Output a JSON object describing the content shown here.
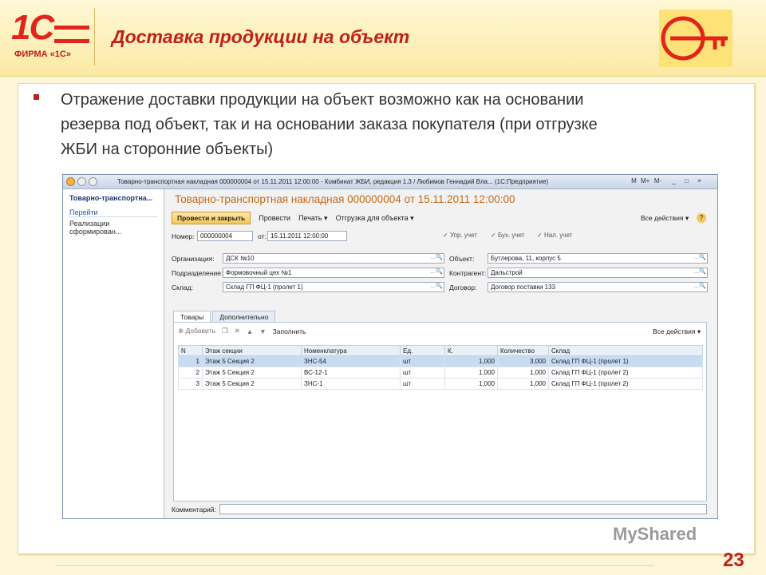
{
  "slide": {
    "title": "Доставка продукции на объект",
    "logo_text": "1С",
    "logo_sub": "ФИРМА «1С»",
    "bullet_lines": [
      "Отражение доставки продукции на объект возможно как на основании",
      "резерва под объект, так и на основании заказа покупателя (при отгрузке",
      "ЖБИ на сторонние объекты)"
    ],
    "page_number": "23",
    "watermark": "MyShared"
  },
  "window": {
    "title": "Товарно-транспортная накладная 000000004 от 15.11.2011 12:00:00 - Комбинат ЖБИ, редакция 1.3 / Любимов Геннадий Вла...  (1С:Предприятие)",
    "buttons": [
      "М",
      "М+",
      "М-",
      "_",
      "□",
      "×"
    ]
  },
  "sidebar": {
    "heading": "Товарно-транспортна...",
    "goto": "Перейти",
    "item": "Реализации сформирован..."
  },
  "form": {
    "header": "Товарно-транспортная накладная 000000004 от 15.11.2011 12:00:00",
    "post_close": "Провести и закрыть",
    "post": "Провести",
    "print": "Печать ▾",
    "shipment": "Отгрузка для объекта ▾",
    "all_actions": "Все действия ▾",
    "help": "?",
    "number_label": "Номер:",
    "number": "000000004",
    "date_label": "от:",
    "date": "15.11.2011 12:00:00",
    "chk_upr": "Упр. учет",
    "chk_buh": "Бух. учет",
    "chk_nal": "Нал. учет",
    "org_label": "Организация:",
    "org": "ДСК №10",
    "dept_label": "Подразделение:",
    "dept": "Формовочный цех №1",
    "wh_label": "Склад:",
    "wh": "Склад ГП ФЦ-1 (пролет 1)",
    "obj_label": "Объект:",
    "obj": "Бутлерова, 11, корпус 5",
    "contr_label": "Контрагент:",
    "contr": "Дальстрой",
    "dog_label": "Договор:",
    "dog": "Договор поставки 133",
    "tab_goods": "Товары",
    "tab_extra": "Дополнительно",
    "add": "Добавить",
    "fill": "Заполнить",
    "table_actions": "Все действия ▾",
    "comment_label": "Комментарий:"
  },
  "table": {
    "headers": [
      "N",
      "Этаж секции",
      "Номенклатура",
      "Ед.",
      "К.",
      "Количество",
      "Склад"
    ],
    "rows": [
      [
        "1",
        "Этаж 5 Секция 2",
        "ЗНС-54",
        "шт",
        "1,000",
        "3,000",
        "Склад ГП ФЦ-1 (пролет 1)"
      ],
      [
        "2",
        "Этаж 5 Секция 2",
        "ВС-12-1",
        "шт",
        "1,000",
        "1,000",
        "Склад ГП ФЦ-1 (пролет 2)"
      ],
      [
        "3",
        "Этаж 5 Секция 2",
        "ЗНС-1",
        "шт",
        "1,000",
        "1,000",
        "Склад ГП ФЦ-1 (пролет 2)"
      ]
    ]
  }
}
